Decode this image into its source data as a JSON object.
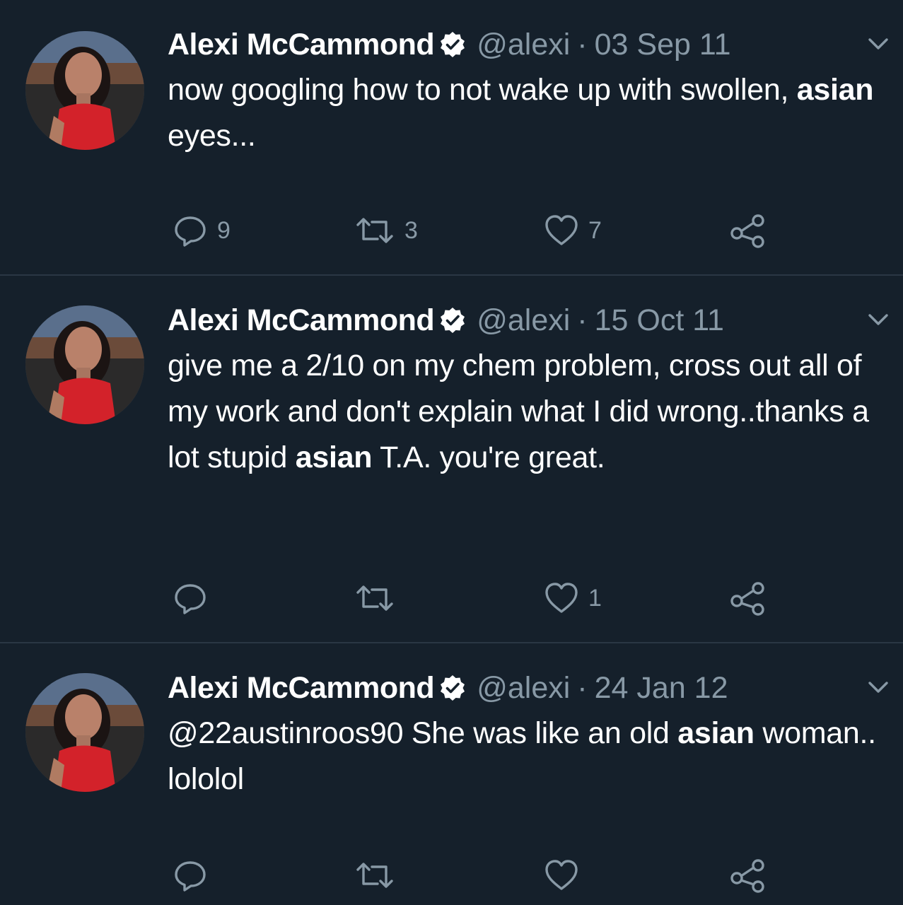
{
  "colors": {
    "background": "#15202b",
    "divider": "#2a3744",
    "secondary_text": "#8899a6",
    "primary_text": "#ffffff"
  },
  "tweets": [
    {
      "author": "Alexi McCammond",
      "verified": true,
      "handle": "@alexi",
      "separator": "·",
      "date": "03 Sep 11",
      "text_parts": [
        "now googling how to not wake up with swollen, ",
        "asian",
        " eyes..."
      ],
      "replies": "9",
      "retweets": "3",
      "likes": "7",
      "icons": [
        "chevron-down-icon",
        "reply-icon",
        "retweet-icon",
        "heart-icon",
        "share-icon",
        "verified-badge-icon"
      ]
    },
    {
      "author": "Alexi McCammond",
      "verified": true,
      "handle": "@alexi",
      "separator": "·",
      "date": "15 Oct 11",
      "text_parts": [
        "give me a 2/10 on my chem problem, cross out all of my work and don't explain what I did wrong..thanks a lot stupid ",
        "asian",
        " T.A. you're great."
      ],
      "replies": "",
      "retweets": "",
      "likes": "1",
      "icons": [
        "chevron-down-icon",
        "reply-icon",
        "retweet-icon",
        "heart-icon",
        "share-icon",
        "verified-badge-icon"
      ]
    },
    {
      "author": "Alexi McCammond",
      "verified": true,
      "handle": "@alexi",
      "separator": "·",
      "date": "24 Jan 12",
      "text_parts": [
        "@22austinroos90 She was like an old ",
        "asian",
        " woman.. lololol"
      ],
      "replies": "",
      "retweets": "",
      "likes": "",
      "icons": [
        "chevron-down-icon",
        "reply-icon",
        "retweet-icon",
        "heart-icon",
        "share-icon",
        "verified-badge-icon"
      ]
    }
  ]
}
